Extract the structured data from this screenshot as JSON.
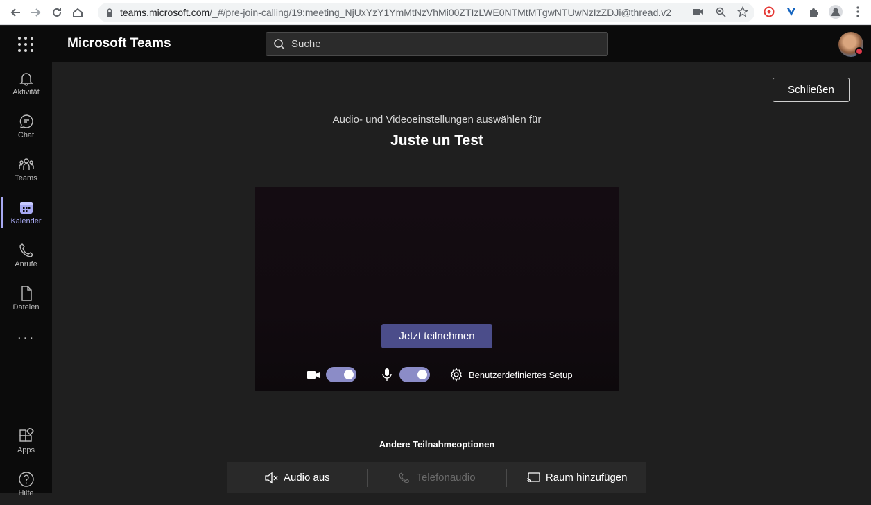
{
  "browser": {
    "url_host": "teams.microsoft.com",
    "url_path": "/_#/pre-join-calling/19:meeting_NjUxYzY1YmMtNzVhMi00ZTIzLWE0NTMtMTgwNTUwNzIzZDJi@thread.v2"
  },
  "header": {
    "app_title": "Microsoft Teams",
    "search_placeholder": "Suche"
  },
  "rail": {
    "items": [
      {
        "label": "Aktivität",
        "icon": "bell-icon"
      },
      {
        "label": "Chat",
        "icon": "chat-icon"
      },
      {
        "label": "Teams",
        "icon": "teams-icon"
      },
      {
        "label": "Kalender",
        "icon": "calendar-icon",
        "active": true
      },
      {
        "label": "Anrufe",
        "icon": "phone-icon"
      },
      {
        "label": "Dateien",
        "icon": "file-icon"
      }
    ],
    "more": "···",
    "bottom": [
      {
        "label": "Apps",
        "icon": "apps-icon"
      },
      {
        "label": "Hilfe",
        "icon": "help-icon"
      }
    ]
  },
  "main": {
    "close_label": "Schließen",
    "subtitle": "Audio- und Videoeinstellungen auswählen für",
    "meeting_title": "Juste un Test",
    "join_label": "Jetzt teilnehmen",
    "video_on": true,
    "mic_on": true,
    "custom_setup_label": "Benutzerdefiniertes Setup",
    "other_options_title": "Andere Teilnahmeoptionen",
    "options": [
      {
        "label": "Audio aus",
        "icon": "speaker-off-icon",
        "enabled": true
      },
      {
        "label": "Telefonaudio",
        "icon": "phone-icon",
        "enabled": false
      },
      {
        "label": "Raum hinzufügen",
        "icon": "cast-icon",
        "enabled": true
      }
    ]
  },
  "colors": {
    "accent": "#a7a9f2",
    "join_button": "#4b4d8a",
    "toggle_on": "#8b8cc7",
    "presence_busy": "#e0394b"
  }
}
